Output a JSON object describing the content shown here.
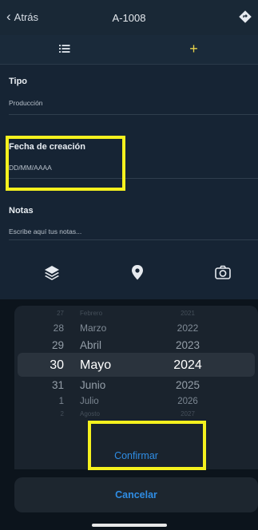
{
  "nav": {
    "back_label": "Atrás",
    "title": "A-1008",
    "action_icon": "diamond-turn-icon"
  },
  "tabs": [
    {
      "icon": "list-icon",
      "selected": false
    },
    {
      "icon": "plus-icon",
      "glyph": "+",
      "selected": true,
      "color": "#e8d24a"
    }
  ],
  "form": {
    "tipo": {
      "label": "Tipo",
      "value": "Producción"
    },
    "fecha": {
      "label": "Fecha de creación",
      "value": "DD/MM/AAAA"
    },
    "notas": {
      "label": "Notas",
      "placeholder": "Escribe aquí tus notas..."
    }
  },
  "toolbar": {
    "icons": [
      "layers-icon",
      "location-pin-icon",
      "camera-icon"
    ]
  },
  "picker": {
    "rows": [
      {
        "day": "27",
        "month": "Febrero",
        "year": "2021"
      },
      {
        "day": "28",
        "month": "Marzo",
        "year": "2022"
      },
      {
        "day": "29",
        "month": "Abril",
        "year": "2023"
      },
      {
        "day": "30",
        "month": "Mayo",
        "year": "2024"
      },
      {
        "day": "31",
        "month": "Junio",
        "year": "2025"
      },
      {
        "day": "1",
        "month": "Julio",
        "year": "2026"
      },
      {
        "day": "2",
        "month": "Agosto",
        "year": "2027"
      }
    ],
    "selected": {
      "day": "30",
      "month": "Mayo",
      "year": "2024"
    },
    "confirm_label": "Confirmar",
    "cancel_label": "Cancelar"
  },
  "colors": {
    "highlight": "#f5f11e",
    "action_blue": "#2f8de4",
    "accent_yellow": "#e8d24a"
  }
}
